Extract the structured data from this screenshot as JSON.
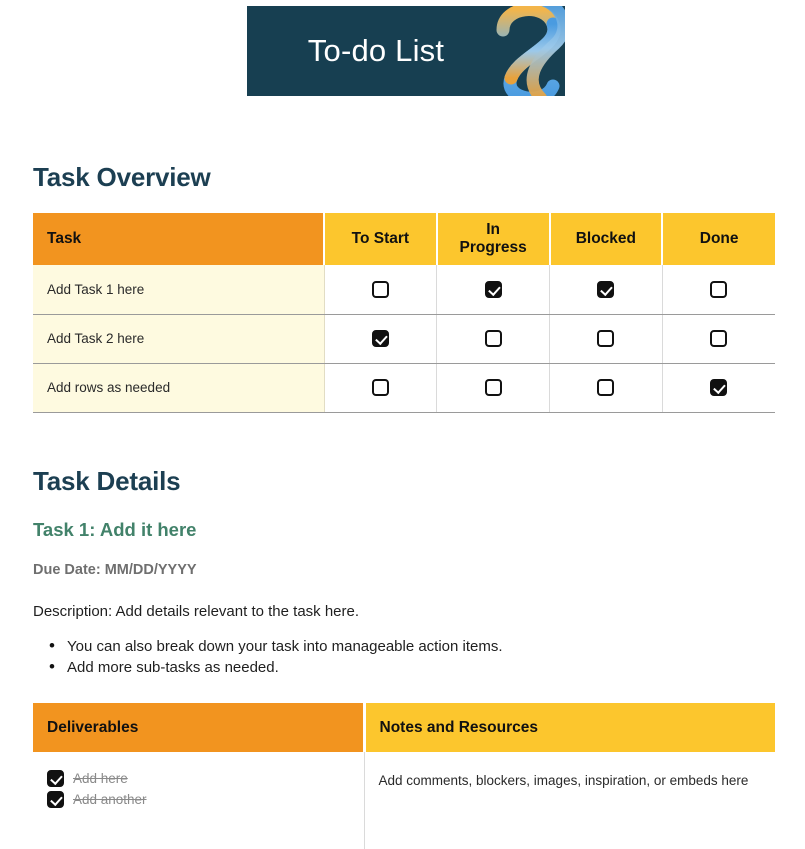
{
  "banner": {
    "title": "To-do List",
    "background_color": "#173F51",
    "deco_icon": "infinity-ribbon-icon",
    "deco_colors": [
      "#4A9BE0",
      "#F3B54A",
      "#7FBEE8",
      "#E8A23C"
    ]
  },
  "colors": {
    "navy": "#173F51",
    "orange": "#F2941F",
    "yellow": "#FCC62D",
    "cream": "#FEFAE0",
    "green": "#42826A",
    "gray_text": "#6f6f6f"
  },
  "sections": {
    "overview_heading": "Task Overview",
    "details_heading": "Task Details"
  },
  "overview_table": {
    "columns": [
      "Task",
      "To Start",
      "In Progress",
      "Blocked",
      "Done"
    ],
    "rows": [
      {
        "task": "Add Task 1 here",
        "to_start": false,
        "in_progress": true,
        "blocked": true,
        "done": false
      },
      {
        "task": "Add Task 2 here",
        "to_start": true,
        "in_progress": false,
        "blocked": false,
        "done": false
      },
      {
        "task": "Add rows as needed",
        "to_start": false,
        "in_progress": false,
        "blocked": false,
        "done": true
      }
    ]
  },
  "task_detail": {
    "title": "Task 1: Add it here",
    "due_date": "Due Date: MM/DD/YYYY",
    "description": "Description: Add details relevant to the task here.",
    "bullets": [
      "You can also break down your task into manageable action items.",
      "Add more sub-tasks as needed."
    ]
  },
  "deliverables_table": {
    "columns": [
      "Deliverables",
      "Notes and Resources"
    ],
    "deliverables": [
      {
        "label": "Add here",
        "checked": true,
        "struck": true
      },
      {
        "label": "Add another",
        "checked": true,
        "struck": true
      }
    ],
    "notes": "Add comments, blockers, images, inspiration, or embeds here"
  }
}
